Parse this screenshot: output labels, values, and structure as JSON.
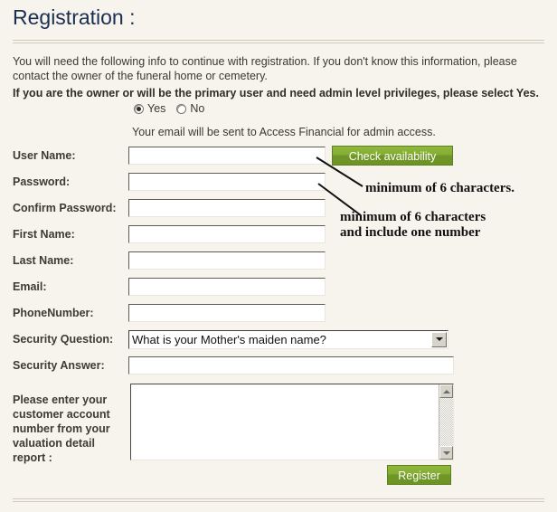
{
  "page": {
    "title": "Registration :",
    "intro": "You will need the following info to continue with registration. If you don't know this information, please contact the owner of the funeral home or cemetery.",
    "intro_bold": "If you are the owner or will be the primary user and need admin level privileges, please select Yes.",
    "email_hint": "Your email will be sent to Access Financial for admin access."
  },
  "admin_choice": {
    "yes_label": "Yes",
    "no_label": "No",
    "selected": "Yes"
  },
  "fields": {
    "user_name": {
      "label": "User Name:",
      "value": "",
      "placeholder": ""
    },
    "password": {
      "label": "Password:",
      "value": "",
      "placeholder": ""
    },
    "confirm_password": {
      "label": "Confirm Password:",
      "value": "",
      "placeholder": ""
    },
    "first_name": {
      "label": "First Name:",
      "value": "",
      "placeholder": ""
    },
    "last_name": {
      "label": "Last Name:",
      "value": "",
      "placeholder": ""
    },
    "email": {
      "label": "Email:",
      "value": "",
      "placeholder": ""
    },
    "phone_number": {
      "label": "PhoneNumber:",
      "value": "",
      "placeholder": ""
    },
    "security_question": {
      "label": "Security Question:",
      "selected": "What is your Mother's maiden name?"
    },
    "security_answer": {
      "label": "Security Answer:",
      "value": "",
      "placeholder": ""
    },
    "account_number": {
      "label": "Please enter your customer account number from your valuation detail report :",
      "value": "",
      "placeholder": ""
    }
  },
  "buttons": {
    "check_availability": "Check availability",
    "register": "Register"
  },
  "annotations": {
    "username_note": "minimum of 6 characters.",
    "password_note": "minimum of 6 characters\nand include one number"
  },
  "colors": {
    "background": "#f6f4ec",
    "title": "#1b2d52",
    "button_green": "#84ad33",
    "button_green_dark": "#6d9425",
    "rule": "#cfcabb"
  }
}
